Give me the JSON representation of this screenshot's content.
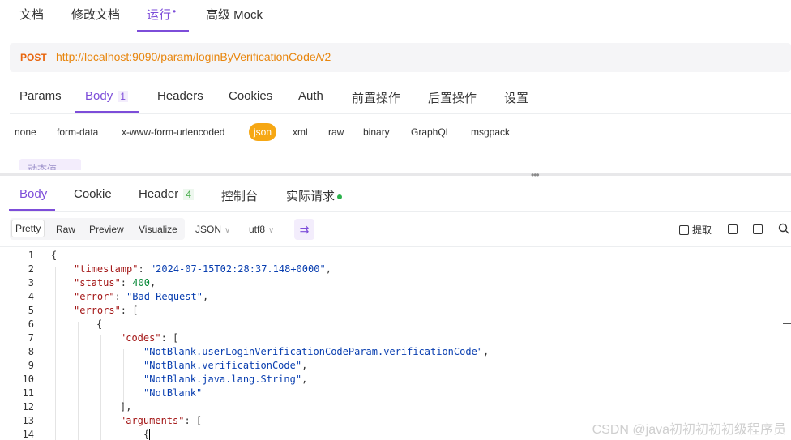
{
  "top_tabs": [
    "文档",
    "修改文档",
    "运行",
    "高级 Mock"
  ],
  "top_active_dot": "•",
  "request": {
    "method": "POST",
    "url": "http://localhost:9090/param/loginByVerificationCode/v2"
  },
  "request_tabs": [
    "Params",
    "Body",
    "Headers",
    "Cookies",
    "Auth",
    "前置操作",
    "后置操作",
    "设置"
  ],
  "body_count": "1",
  "body_types": [
    "none",
    "form-data",
    "x-www-form-urlencoded",
    "json",
    "xml",
    "raw",
    "binary",
    "GraphQL",
    "msgpack"
  ],
  "dynamic_value_label": "动态值",
  "splitter_grip": "•••",
  "response_tabs": [
    "Body",
    "Cookie",
    "Header",
    "控制台",
    "实际请求"
  ],
  "header_count": "4",
  "view_tabs": [
    "Pretty",
    "Raw",
    "Preview",
    "Visualize"
  ],
  "format": "JSON",
  "encoding": "utf8",
  "chevron": "∨",
  "wrap_icon": "⇉",
  "extract_label": "提取",
  "code": {
    "line_numbers": [
      "1",
      "2",
      "3",
      "4",
      "5",
      "6",
      "7",
      "8",
      "9",
      "10",
      "11",
      "12",
      "13",
      "14"
    ],
    "l1": "{",
    "l2_key": "\"timestamp\"",
    "l2_val": "\"2024-07-15T02:28:37.148+0000\"",
    "l3_key": "\"status\"",
    "l3_val": "400",
    "l4_key": "\"error\"",
    "l4_val": "\"Bad Request\"",
    "l5_key": "\"errors\"",
    "l5_rest": ": [",
    "l6": "{",
    "l7_key": "\"codes\"",
    "l7_rest": ": [",
    "l8": "\"NotBlank.userLoginVerificationCodeParam.verificationCode\"",
    "l9": "\"NotBlank.verificationCode\"",
    "l10": "\"NotBlank.java.lang.String\"",
    "l11": "\"NotBlank\"",
    "l12": "],",
    "l13_key": "\"arguments\"",
    "l13_rest": ": [",
    "l14": "{"
  },
  "watermark": "CSDN @java初初初初初级程序员"
}
